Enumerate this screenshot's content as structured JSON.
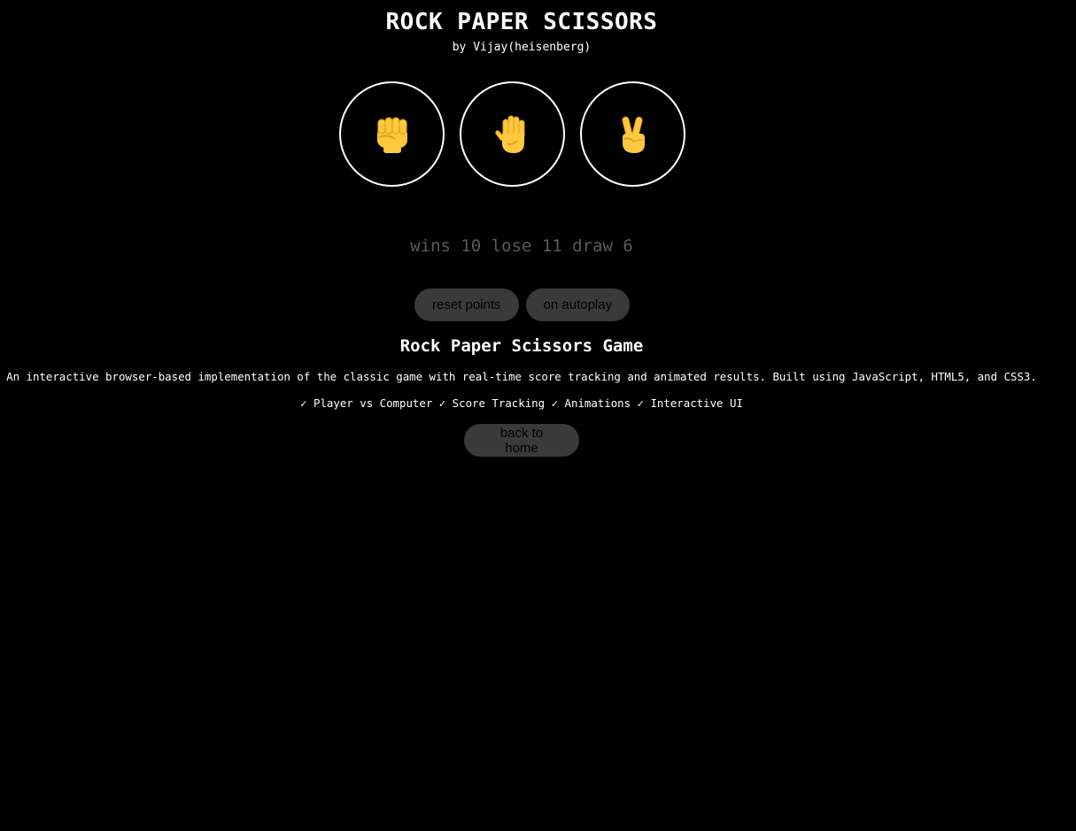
{
  "header": {
    "title": "ROCK PAPER SCISSORS",
    "byline": "by Vijay(heisenberg)"
  },
  "moves": [
    {
      "name": "rock",
      "icon": "raised-fist-icon"
    },
    {
      "name": "paper",
      "icon": "raised-hand-icon"
    },
    {
      "name": "scissors",
      "icon": "victory-hand-icon"
    }
  ],
  "score": {
    "text": "wins 10 lose 11 draw 6",
    "wins": 10,
    "lose": 11,
    "draw": 6
  },
  "controls": {
    "reset_label": "reset points",
    "autoplay_label": "on autoplay"
  },
  "info": {
    "heading": "Rock Paper Scissors Game",
    "description": "An interactive browser-based implementation of the classic game with real-time score tracking and animated results. Built using JavaScript, HTML5, and CSS3.",
    "features": "✓ Player vs Computer ✓ Score Tracking ✓ Animations ✓ Interactive UI"
  },
  "nav": {
    "back_label": "back to home"
  },
  "colors": {
    "background": "#000000",
    "text": "#ffffff",
    "score_text": "#5a5a5a",
    "button_bg": "#3a3a3a",
    "emoji_yellow": "#FFC83D",
    "emoji_shade": "#E0A020"
  }
}
